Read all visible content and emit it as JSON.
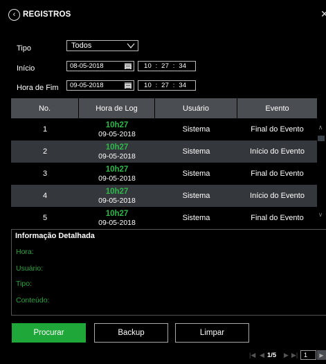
{
  "header": {
    "title": "REGISTROS"
  },
  "form": {
    "type_label": "Tipo",
    "type_value": "Todos",
    "start_label": "Início",
    "start_date": "08-05-2018",
    "start_time": "10  :  27  :  34",
    "end_label": "Hora de Fim",
    "end_date": "09-05-2018",
    "end_time": "10  :  27  :  34"
  },
  "table": {
    "headers": [
      "No.",
      "Hora de Log",
      "Usuário",
      "Evento"
    ],
    "rows": [
      {
        "no": "1",
        "time": "10h27",
        "date": "09-05-2018",
        "user": "Sistema",
        "event": "Final do Evento"
      },
      {
        "no": "2",
        "time": "10h27",
        "date": "09-05-2018",
        "user": "Sistema",
        "event": "Início do Evento"
      },
      {
        "no": "3",
        "time": "10h27",
        "date": "09-05-2018",
        "user": "Sistema",
        "event": "Final do Evento"
      },
      {
        "no": "4",
        "time": "10h27",
        "date": "09-05-2018",
        "user": "Sistema",
        "event": "Início do Evento"
      },
      {
        "no": "5",
        "time": "10h27",
        "date": "09-05-2018",
        "user": "Sistema",
        "event": "Final do Evento"
      }
    ]
  },
  "detail": {
    "title": "Informação Detalhada",
    "hora_label": "Hora:",
    "usuario_label": "Usuário:",
    "tipo_label": "Tipo:",
    "conteudo_label": "Conteúdo:"
  },
  "buttons": {
    "search": "Procurar",
    "backup": "Backup",
    "clear": "Limpar"
  },
  "pagination": {
    "info": "1/5",
    "page_input": "1"
  },
  "colors": {
    "accent": "#20a73a",
    "header_bg": "#4a4d51",
    "alt_row": "#34373b"
  }
}
